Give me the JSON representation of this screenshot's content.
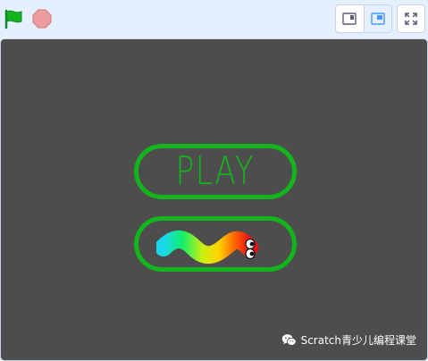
{
  "controls": {
    "green_flag": {
      "icon": "green-flag-icon",
      "color": "#12b51b"
    },
    "stop": {
      "icon": "stop-sign-icon",
      "color": "#ec9c9c"
    },
    "small_stage": {
      "icon": "small-stage-icon"
    },
    "large_stage": {
      "icon": "large-stage-icon",
      "selected": true
    },
    "fullscreen": {
      "icon": "fullscreen-icon"
    }
  },
  "stage": {
    "background": "#4d4d4d",
    "play_button": {
      "label": "PLAY",
      "color": "#12b51b"
    },
    "skin_button": {
      "icon": "rainbow-worm-icon"
    },
    "watermark": {
      "icon": "wechat-icon",
      "text": "Scratch青少儿编程课堂"
    }
  }
}
